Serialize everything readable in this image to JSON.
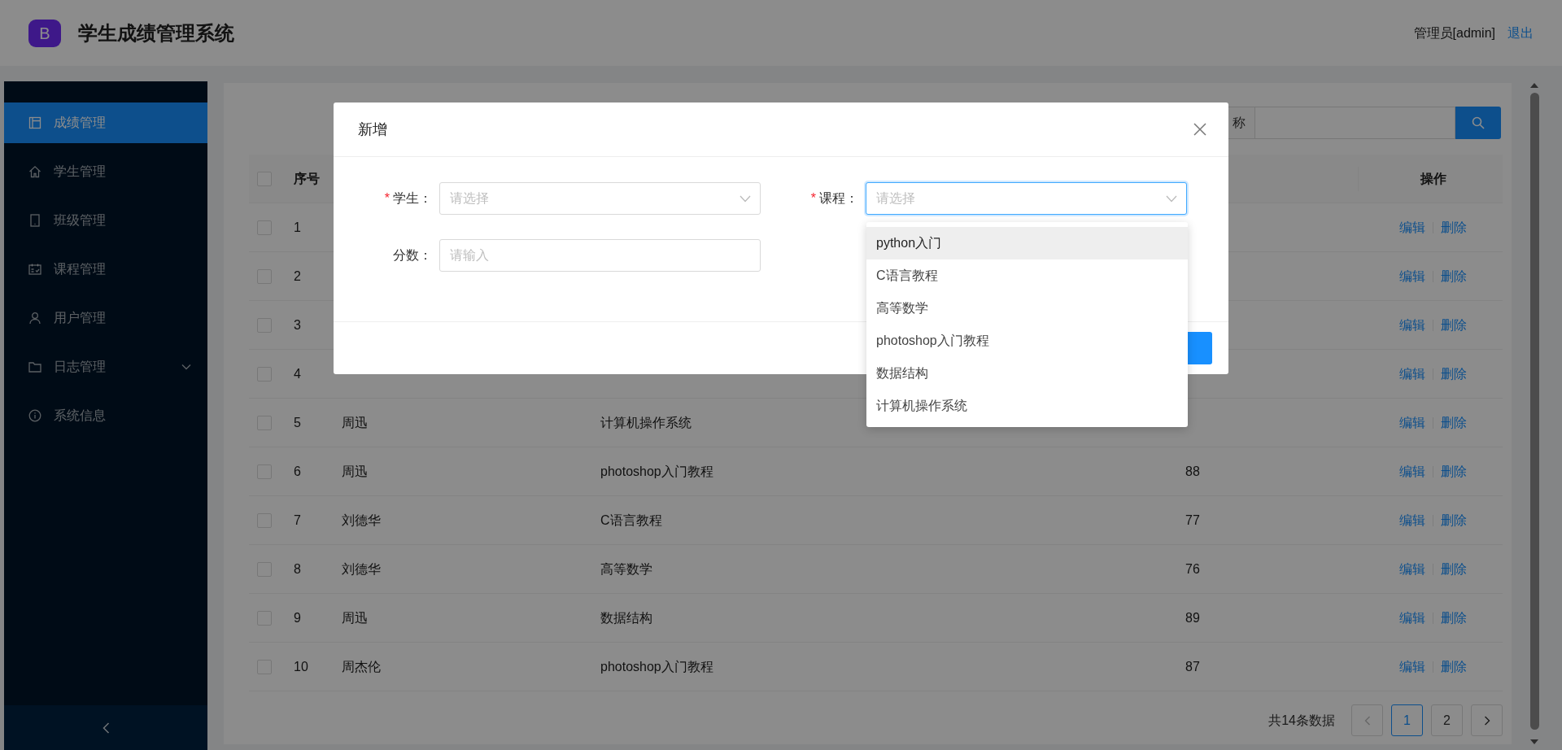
{
  "header": {
    "logo": "B",
    "title": "学生成绩管理系统",
    "user": "管理员[admin]",
    "logout": "退出"
  },
  "sidebar": {
    "items": [
      {
        "label": "成绩管理",
        "selected": true,
        "has_submenu": false
      },
      {
        "label": "学生管理",
        "selected": false,
        "has_submenu": false
      },
      {
        "label": "班级管理",
        "selected": false,
        "has_submenu": false
      },
      {
        "label": "课程管理",
        "selected": false,
        "has_submenu": false
      },
      {
        "label": "用户管理",
        "selected": false,
        "has_submenu": false
      },
      {
        "label": "日志管理",
        "selected": false,
        "has_submenu": true
      },
      {
        "label": "系统信息",
        "selected": false,
        "has_submenu": false
      }
    ]
  },
  "search": {
    "label": "称"
  },
  "table": {
    "columns": {
      "index": "序号",
      "actions": "操作"
    },
    "all_checked": false,
    "rows": [
      {
        "index": "1",
        "checked": false,
        "actions": [
          "编辑",
          "删除"
        ]
      },
      {
        "index": "2",
        "checked": false,
        "actions": [
          "编辑",
          "删除"
        ]
      },
      {
        "index": "3",
        "checked": false,
        "actions": [
          "编辑",
          "删除"
        ]
      },
      {
        "index": "4",
        "checked": false,
        "actions": [
          "编辑",
          "删除"
        ]
      },
      {
        "index": "5",
        "student": "周迅",
        "course": "计算机操作系统",
        "checked": false,
        "actions": [
          "编辑",
          "删除"
        ]
      },
      {
        "index": "6",
        "student": "周迅",
        "course": "photoshop入门教程",
        "score": "88",
        "checked": false,
        "actions": [
          "编辑",
          "删除"
        ]
      },
      {
        "index": "7",
        "student": "刘德华",
        "course": "C语言教程",
        "score": "77",
        "checked": false,
        "actions": [
          "编辑",
          "删除"
        ]
      },
      {
        "index": "8",
        "student": "刘德华",
        "course": "高等数学",
        "score": "76",
        "checked": false,
        "actions": [
          "编辑",
          "删除"
        ]
      },
      {
        "index": "9",
        "student": "周迅",
        "course": "数据结构",
        "score": "89",
        "checked": false,
        "actions": [
          "编辑",
          "删除"
        ]
      },
      {
        "index": "10",
        "student": "周杰伦",
        "course": "photoshop入门教程",
        "score": "87",
        "checked": false,
        "actions": [
          "编辑",
          "删除"
        ]
      }
    ]
  },
  "pagination": {
    "total": "共14条数据",
    "pages": [
      {
        "label": "1",
        "selected": true
      },
      {
        "label": "2",
        "selected": false
      }
    ]
  },
  "modal": {
    "title": "新增",
    "fields": [
      {
        "required_mark": "*",
        "label": "学生：",
        "kind": "select",
        "focused": false,
        "placeholder": "请选择"
      },
      {
        "required_mark": "*",
        "label": "课程：",
        "kind": "select",
        "focused": true,
        "placeholder": "请选择"
      },
      {
        "label": "分数：",
        "kind": "input",
        "focused": false,
        "placeholder": "请输入"
      }
    ],
    "dropdown": {
      "options": [
        {
          "label": "python入门",
          "selected": true
        },
        {
          "label": "C语言教程",
          "selected": false
        },
        {
          "label": "高等数学",
          "selected": false
        },
        {
          "label": "photoshop入门教程",
          "selected": false
        },
        {
          "label": "数据结构",
          "selected": false
        },
        {
          "label": "计算机操作系统",
          "selected": false
        }
      ]
    }
  }
}
